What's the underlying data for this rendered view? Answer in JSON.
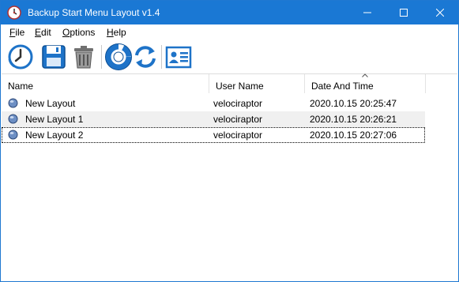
{
  "window": {
    "title": "Backup Start Menu Layout v1.4"
  },
  "menu": [
    {
      "key": "F",
      "rest": "ile"
    },
    {
      "key": "E",
      "rest": "dit"
    },
    {
      "key": "O",
      "rest": "ptions"
    },
    {
      "key": "H",
      "rest": "elp"
    }
  ],
  "toolbar": {
    "icons": [
      "clock-backup-icon",
      "save-disk-icon",
      "trash-can-icon",
      "lifebuoy-icon",
      "refresh-icon",
      "contact-card-icon"
    ]
  },
  "columns": [
    "Name",
    "User Name",
    "Date And Time"
  ],
  "sort": {
    "column": "Date And Time",
    "direction": "ascending"
  },
  "rows": [
    {
      "name": "New Layout",
      "user": "velociraptor",
      "datetime": "2020.10.15 20:25:47"
    },
    {
      "name": "New Layout 1",
      "user": "velociraptor",
      "datetime": "2020.10.15 20:26:21"
    },
    {
      "name": "New Layout 2",
      "user": "velociraptor",
      "datetime": "2020.10.15 20:27:06"
    }
  ],
  "colors": {
    "titlebar": "#1a78d4",
    "accent_blue": "#1e73c8",
    "alt_row": "#f0f0f0"
  }
}
